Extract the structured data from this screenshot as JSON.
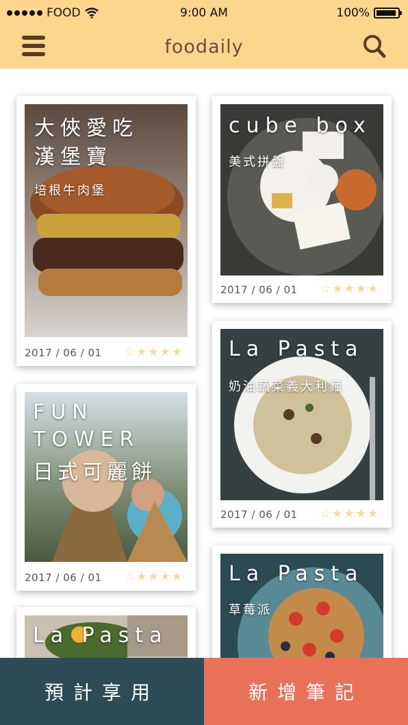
{
  "status": {
    "carrier": "FOOD",
    "time": "9:00 AM",
    "battery": "100%"
  },
  "header": {
    "brand": "foodaily",
    "menu_icon": "hamburger-menu-icon",
    "search_icon": "search-icon",
    "background": "#fdd68e"
  },
  "cards": [
    {
      "title_lines": [
        "大俠愛吃",
        "漢堡寶"
      ],
      "subtitle": "培根牛肉堡",
      "date": "2017 / 06 / 01",
      "stars": "☆★★★★"
    },
    {
      "title_lines": [
        "cube box"
      ],
      "subtitle": "美式拼盤",
      "date": "2017 / 06 / 01",
      "stars": "☆★★★★"
    },
    {
      "title_lines": [
        "La Pasta"
      ],
      "subtitle": "奶油蔬菜義大利麵",
      "date": "2017 / 06 / 01",
      "stars": "☆★★★★"
    },
    {
      "title_lines": [
        "FUN",
        "TOWER",
        "日式可麗餅"
      ],
      "subtitle": "",
      "date": "2017 / 06 / 01",
      "stars": "☆★★★★"
    },
    {
      "title_lines": [
        "La Pasta"
      ],
      "subtitle": "草莓派",
      "date": "",
      "stars": ""
    },
    {
      "title_lines": [
        "La Pasta"
      ],
      "subtitle": "",
      "date": "",
      "stars": ""
    }
  ],
  "bottom": {
    "plan_label": "預計享用",
    "add_label": "新增筆記",
    "plan_color": "#2c4b56",
    "add_color": "#e8715a"
  }
}
